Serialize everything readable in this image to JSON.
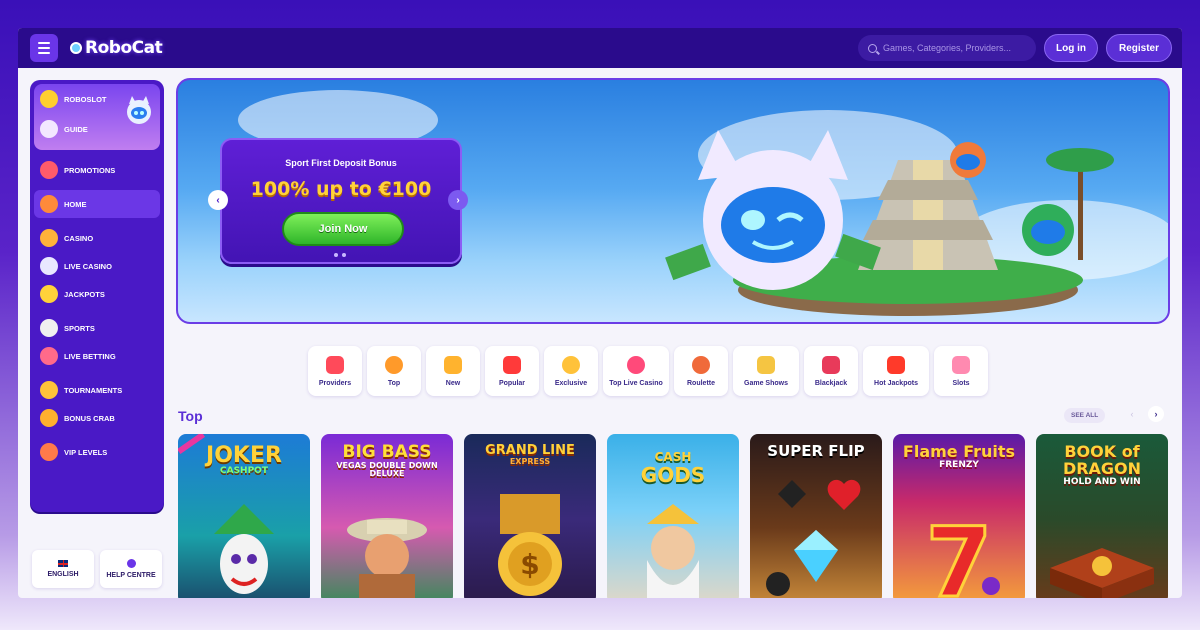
{
  "header": {
    "logo": "RoboCat",
    "search_placeholder": "Games, Categories, Providers...",
    "login_label": "Log in",
    "register_label": "Register"
  },
  "sidebar": {
    "top_items": [
      {
        "label": "ROBOSLOT",
        "icon": "roboslot-icon"
      },
      {
        "label": "GUIDE",
        "icon": "guide-icon"
      }
    ],
    "items": [
      {
        "label": "PROMOTIONS",
        "icon": "gift-icon"
      },
      {
        "label": "HOME",
        "icon": "home-icon"
      },
      {
        "label": "CASINO",
        "icon": "casino-icon"
      },
      {
        "label": "LIVE CASINO",
        "icon": "live-casino-icon"
      },
      {
        "label": "JACKPOTS",
        "icon": "jackpot-icon"
      },
      {
        "label": "SPORTS",
        "icon": "sports-icon"
      },
      {
        "label": "LIVE BETTING",
        "icon": "live-betting-icon"
      },
      {
        "label": "TOURNAMENTS",
        "icon": "trophy-icon"
      },
      {
        "label": "BONUS CRAB",
        "icon": "bonus-crab-icon"
      },
      {
        "label": "VIP LEVELS",
        "icon": "vip-icon"
      }
    ],
    "language_label": "ENGLISH",
    "help_label": "HELP CENTRE"
  },
  "hero": {
    "subtitle": "Sport First Deposit Bonus",
    "title": "100% up to €100",
    "cta_label": "Join Now",
    "prev_arrow": "‹",
    "next_arrow": "›"
  },
  "categories": [
    "Providers",
    "Top",
    "New",
    "Popular",
    "Exclusive",
    "Top Live Casino",
    "Roulette",
    "Game Shows",
    "Blackjack",
    "Hot Jackpots",
    "Slots"
  ],
  "section": {
    "title": "Top",
    "see_all_label": "SEE ALL",
    "prev_arrow": "‹",
    "next_arrow": "›"
  },
  "games": [
    {
      "title": "JOKER",
      "subtitle": "CASHPOT"
    },
    {
      "title": "BIG BASS",
      "subtitle": "VEGAS DOUBLE DOWN DELUXE"
    },
    {
      "title": "GRAND LINE",
      "subtitle": "EXPRESS"
    },
    {
      "title": "CASH",
      "subtitle": "GODS"
    },
    {
      "title": "SUPER FLIP",
      "subtitle": ""
    },
    {
      "title": "Flame Fruits",
      "subtitle": "FRENZY"
    },
    {
      "title": "BOOK of DRAGON",
      "subtitle": "HOLD AND WIN"
    }
  ],
  "colors": {
    "brand_purple": "#4a19c6",
    "accent_yellow": "#ffd23a",
    "cta_green": "#2fb52a"
  }
}
